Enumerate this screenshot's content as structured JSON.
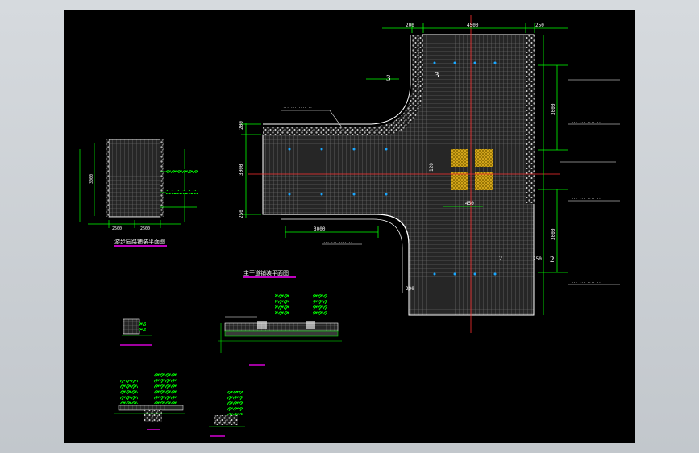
{
  "colors": {
    "background": "#000000",
    "frame": "#c8cdd2",
    "line_green": "#00ff00",
    "line_white": "#ffffff",
    "line_red": "#ff3030",
    "accent_magenta": "#ff00ff",
    "paving_gold": "#c8a000",
    "hatch_grey": "#8a8a8a"
  },
  "main_plan": {
    "dim_top_left": "200",
    "dim_top_mid": "4500",
    "dim_top_right": "250",
    "dim_left_top": "200",
    "dim_left_mid": "3000",
    "dim_left_bottom": "250",
    "dim_right_upper": "3000",
    "dim_right_lower": "3000",
    "dim_bottom_branch": "3000",
    "dim_bottom_stem": "200",
    "dim_center": "450",
    "dim_center_small": "120",
    "section_mark_3": "3",
    "section_mark_2": "2",
    "section_mark_3b": "3",
    "section_mark_2b": "2",
    "note_generic": "... ...  ....  .."
  },
  "small_plan": {
    "dim_width_left": "2500",
    "dim_width_right": "2500",
    "dim_height": "3000"
  },
  "title_small": "游步园路铺装平面图",
  "title_main": "主干道铺装平面图"
}
